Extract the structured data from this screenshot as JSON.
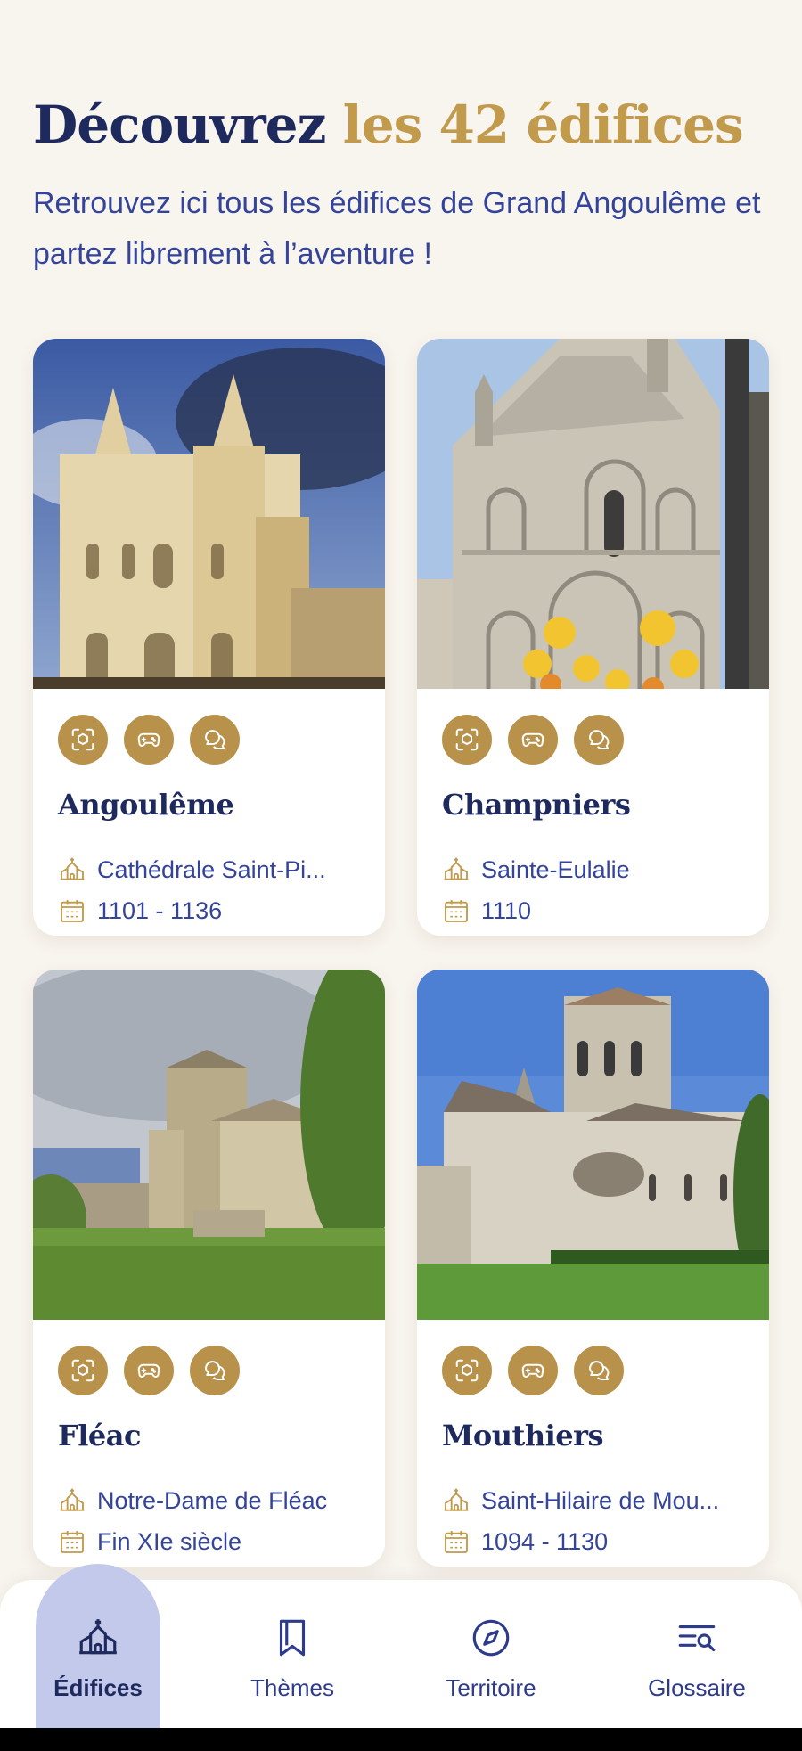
{
  "header": {
    "title_part1": "Découvrez",
    "title_part2": "les 42 édifices",
    "subtitle": "Retrouvez ici tous les édifices de Grand Angoulême et partez librement à l’aventure !"
  },
  "cards": [
    {
      "commune": "Angoulême",
      "edifice": "Cathédrale Saint-Pi...",
      "dates": "1101 - 1136"
    },
    {
      "commune": "Champniers",
      "edifice": "Sainte-Eulalie",
      "dates": "1110"
    },
    {
      "commune": "Fléac",
      "edifice": "Notre-Dame de Fléac",
      "dates": "Fin XIe siècle"
    },
    {
      "commune": "Mouthiers",
      "edifice": "Saint-Hilaire de Mou...",
      "dates": "1094 - 1130"
    }
  ],
  "badge_icons": [
    "ar-scan-icon",
    "gamepad-icon",
    "chat-bubbles-icon"
  ],
  "nav": {
    "items": [
      {
        "label": "Édifices",
        "icon": "church-icon",
        "active": true
      },
      {
        "label": "Thèmes",
        "icon": "bookmark-icon",
        "active": false
      },
      {
        "label": "Territoire",
        "icon": "compass-icon",
        "active": false
      },
      {
        "label": "Glossaire",
        "icon": "list-search-icon",
        "active": false
      }
    ]
  },
  "colors": {
    "background": "#f8f4ee",
    "navy": "#1e2a5e",
    "gold": "#c19a4b",
    "badge": "#b8924b",
    "blue_text": "#34449a",
    "nav_active": "#c3c9ea"
  }
}
